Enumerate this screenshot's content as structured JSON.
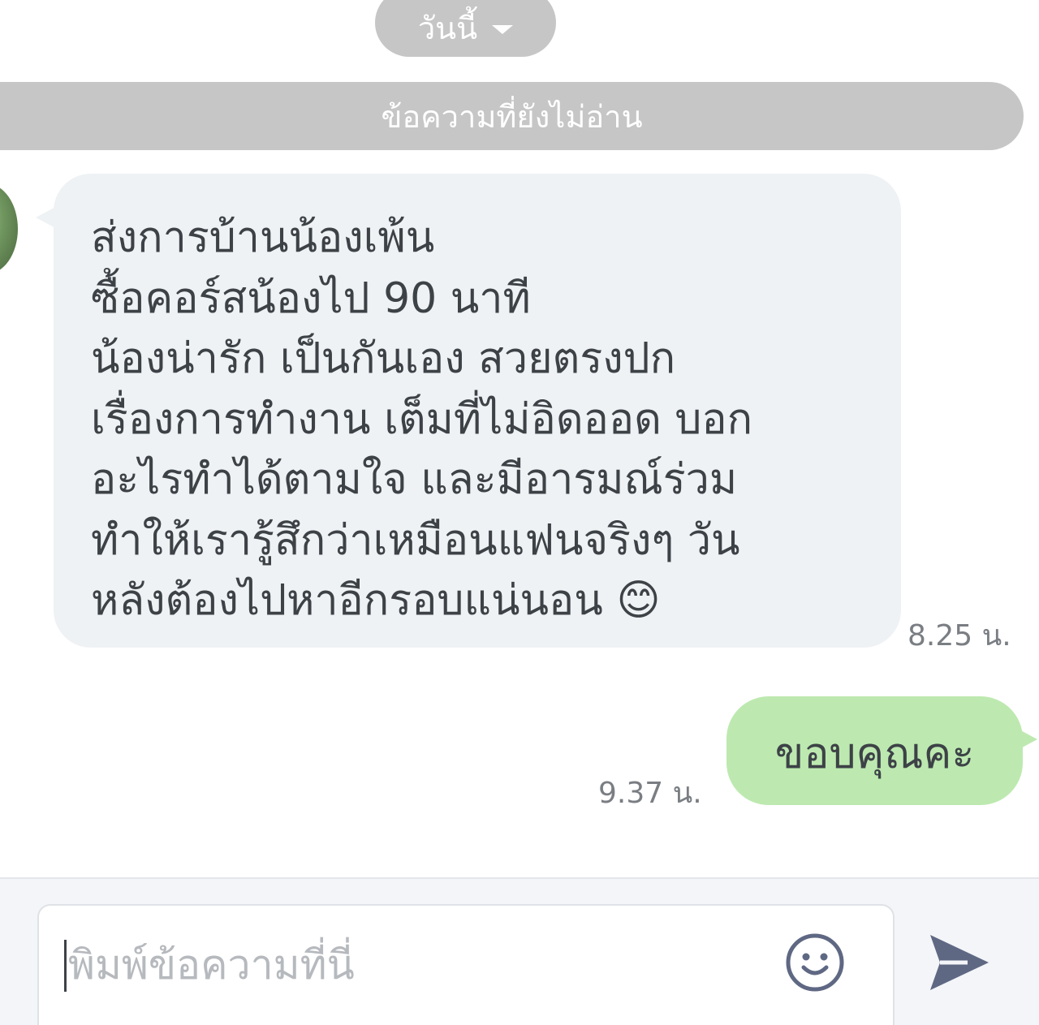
{
  "date_separator": {
    "label": "วันนี้"
  },
  "unread_divider": {
    "label": "ข้อความที่ยังไม่อ่าน"
  },
  "messages": [
    {
      "direction": "incoming",
      "text": "ส่งการบ้านน้องเพ้น\nซื้อคอร์สน้องไป 90 นาที\nน้องน่ารัก เป็นกันเอง สวยตรงปก\nเรื่องการทำงาน เต็มที่ไม่อิดออด บอก\nอะไรทำได้ตามใจ และมีอารมณ์ร่วม\nทำให้เรารู้สึกว่าเหมือนแฟนจริงๆ วัน\nหลังต้องไปหาอีกรอบแน่นอน 😊",
      "time": "8.25 น."
    },
    {
      "direction": "outgoing",
      "text": "ขอบคุณคะ",
      "time": "9.37 น."
    }
  ],
  "composer": {
    "placeholder": "พิมพ์ข้อความที่นี่",
    "emoji_icon": "smiley-icon",
    "send_icon": "send-arrow-icon"
  },
  "colors": {
    "pill_gray": "#c6c6c6",
    "incoming_bubble": "#eff2f4",
    "outgoing_bubble": "#bde9b0",
    "text": "#3d4247",
    "timestamp": "#7a7e83",
    "icon": "#5f6883"
  }
}
